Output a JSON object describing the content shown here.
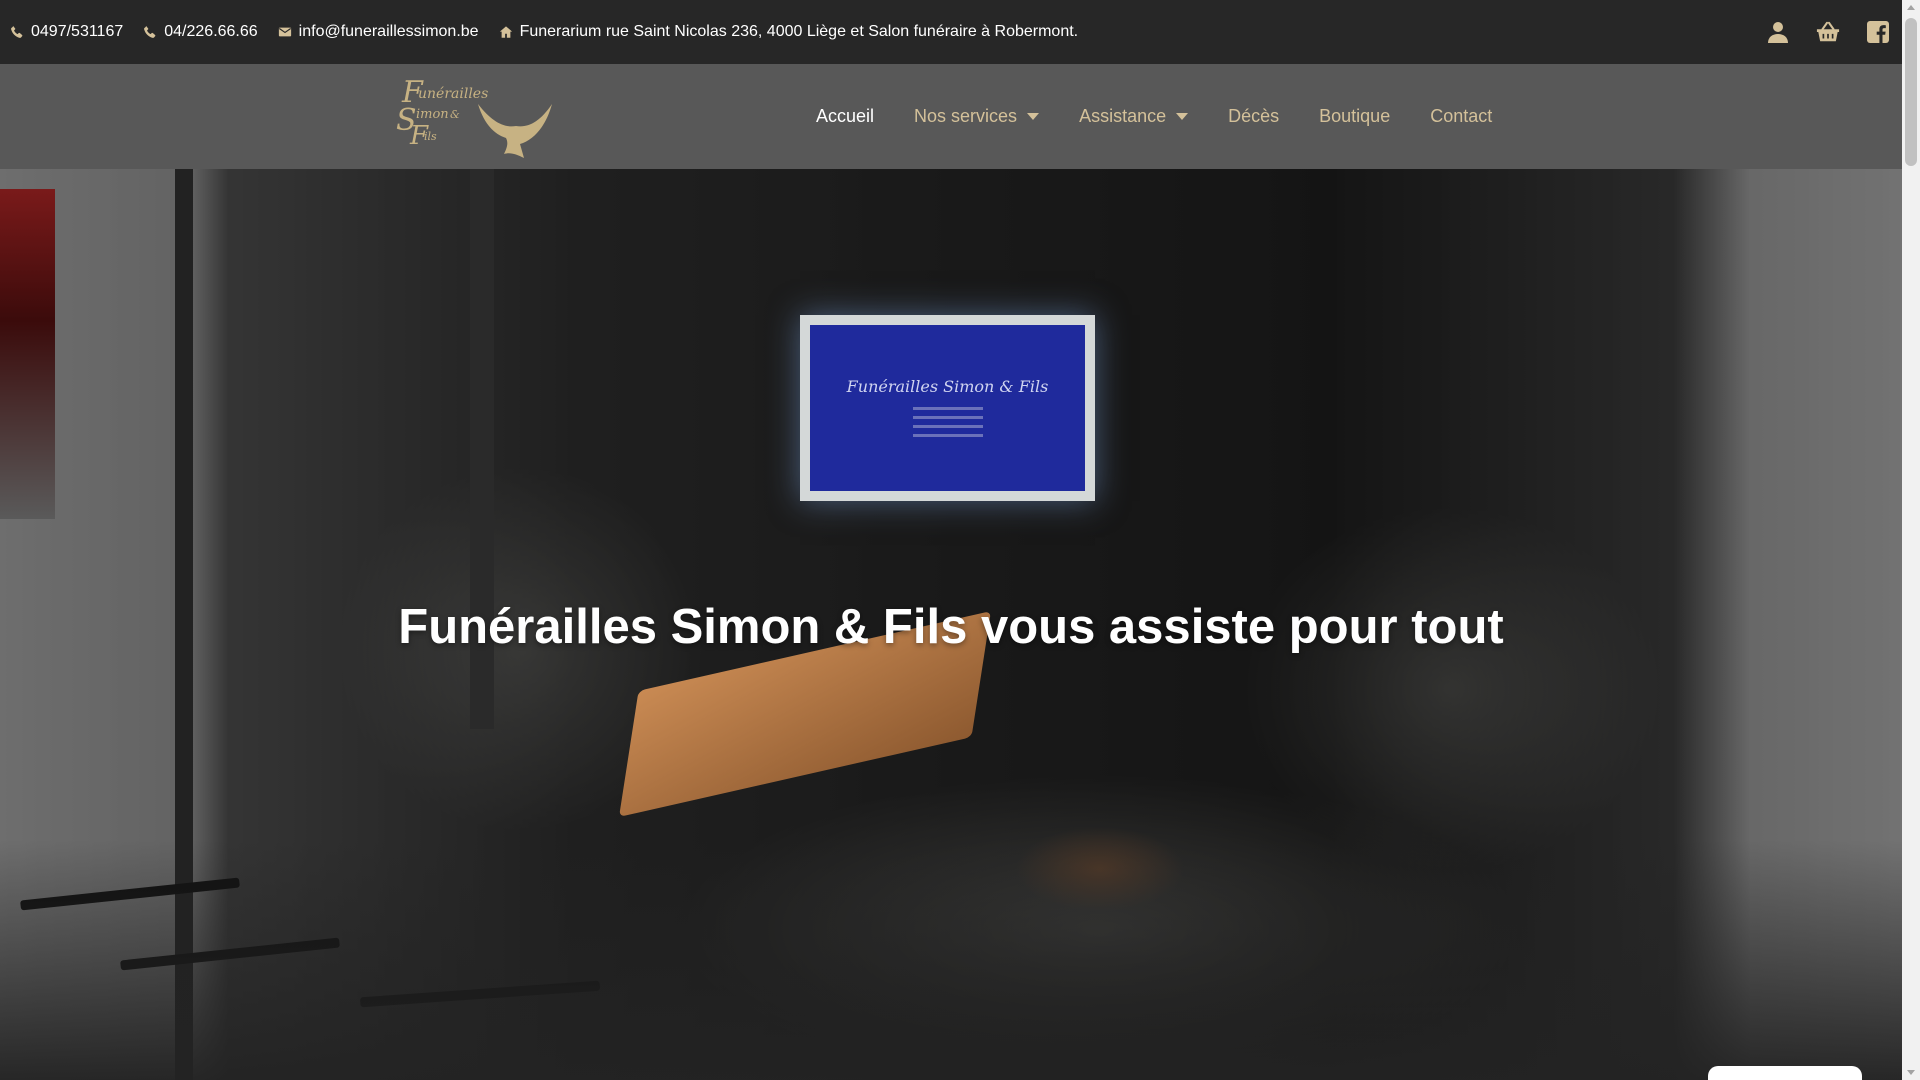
{
  "topbar": {
    "phone_mobile": "0497/531167",
    "phone_landline": "04/226.66.66",
    "email": "info@funeraillessimon.be",
    "address": "Funerarium rue Saint Nicolas 236, 4000 Liège et Salon funéraire à Robermont.",
    "icons": [
      "phone-icon",
      "phone-icon",
      "envelope-icon",
      "home-icon",
      "user-icon",
      "basket-icon",
      "facebook-icon"
    ]
  },
  "header": {
    "logo_alt": "Funérailles Simon & Fils",
    "nav": [
      {
        "label": "Accueil",
        "active": true
      },
      {
        "label": "Nos services",
        "has_dropdown": true
      },
      {
        "label": "Assistance",
        "has_dropdown": true
      },
      {
        "label": "Décès"
      },
      {
        "label": "Boutique"
      },
      {
        "label": "Contact"
      }
    ]
  },
  "hero": {
    "title": "Funérailles Simon & Fils vous assiste pour tout",
    "screen_title": "Funérailles Simon & Fils"
  },
  "colors": {
    "topbar_bg": "#272727",
    "header_bg": "#585858",
    "nav_text": "#d4c19a",
    "nav_active": "#ffffff",
    "icon_gold": "#d4c19a"
  }
}
